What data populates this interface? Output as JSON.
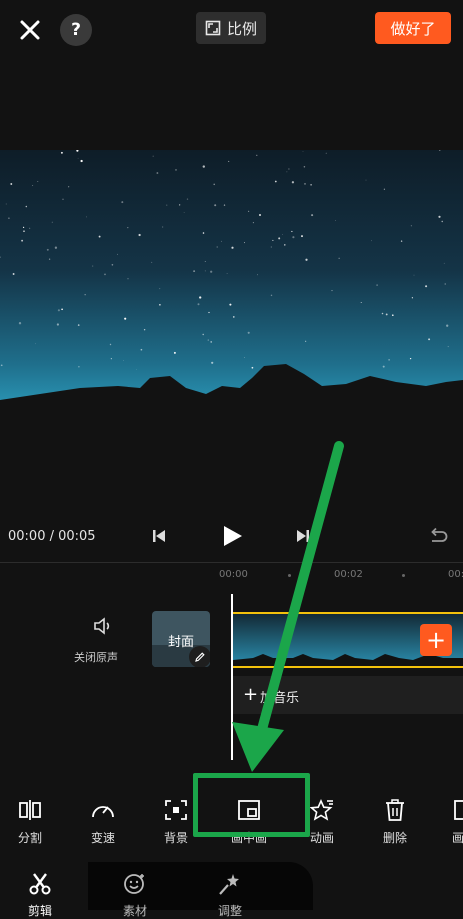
{
  "topbar": {
    "ratio_label": "比例",
    "done_label": "做好了"
  },
  "player": {
    "time": "00:00 / 00:05"
  },
  "ruler": {
    "ticks": [
      "00:00",
      "00:02",
      "00:04"
    ]
  },
  "timeline": {
    "mute_label": "关闭原声",
    "cover_label": "封面",
    "add_music_label": "加音乐"
  },
  "toolbar": {
    "items": [
      {
        "label": "分割",
        "icon": "split-icon"
      },
      {
        "label": "变速",
        "icon": "speed-icon"
      },
      {
        "label": "背景",
        "icon": "background-icon"
      },
      {
        "label": "画中画",
        "icon": "picture-in-picture-icon"
      },
      {
        "label": "动画",
        "icon": "animation-icon"
      },
      {
        "label": "删除",
        "icon": "trash-icon"
      },
      {
        "label": "画面",
        "icon": "frame-icon"
      }
    ]
  },
  "bottom_nav": {
    "items": [
      {
        "label": "剪辑",
        "icon": "scissors-icon"
      },
      {
        "label": "素材",
        "icon": "sticker-icon"
      },
      {
        "label": "调整",
        "icon": "adjust-icon"
      }
    ]
  },
  "colors": {
    "accent": "#ff5a1f",
    "highlight": "#1ba64a",
    "clip_border": "#f3c20c"
  }
}
